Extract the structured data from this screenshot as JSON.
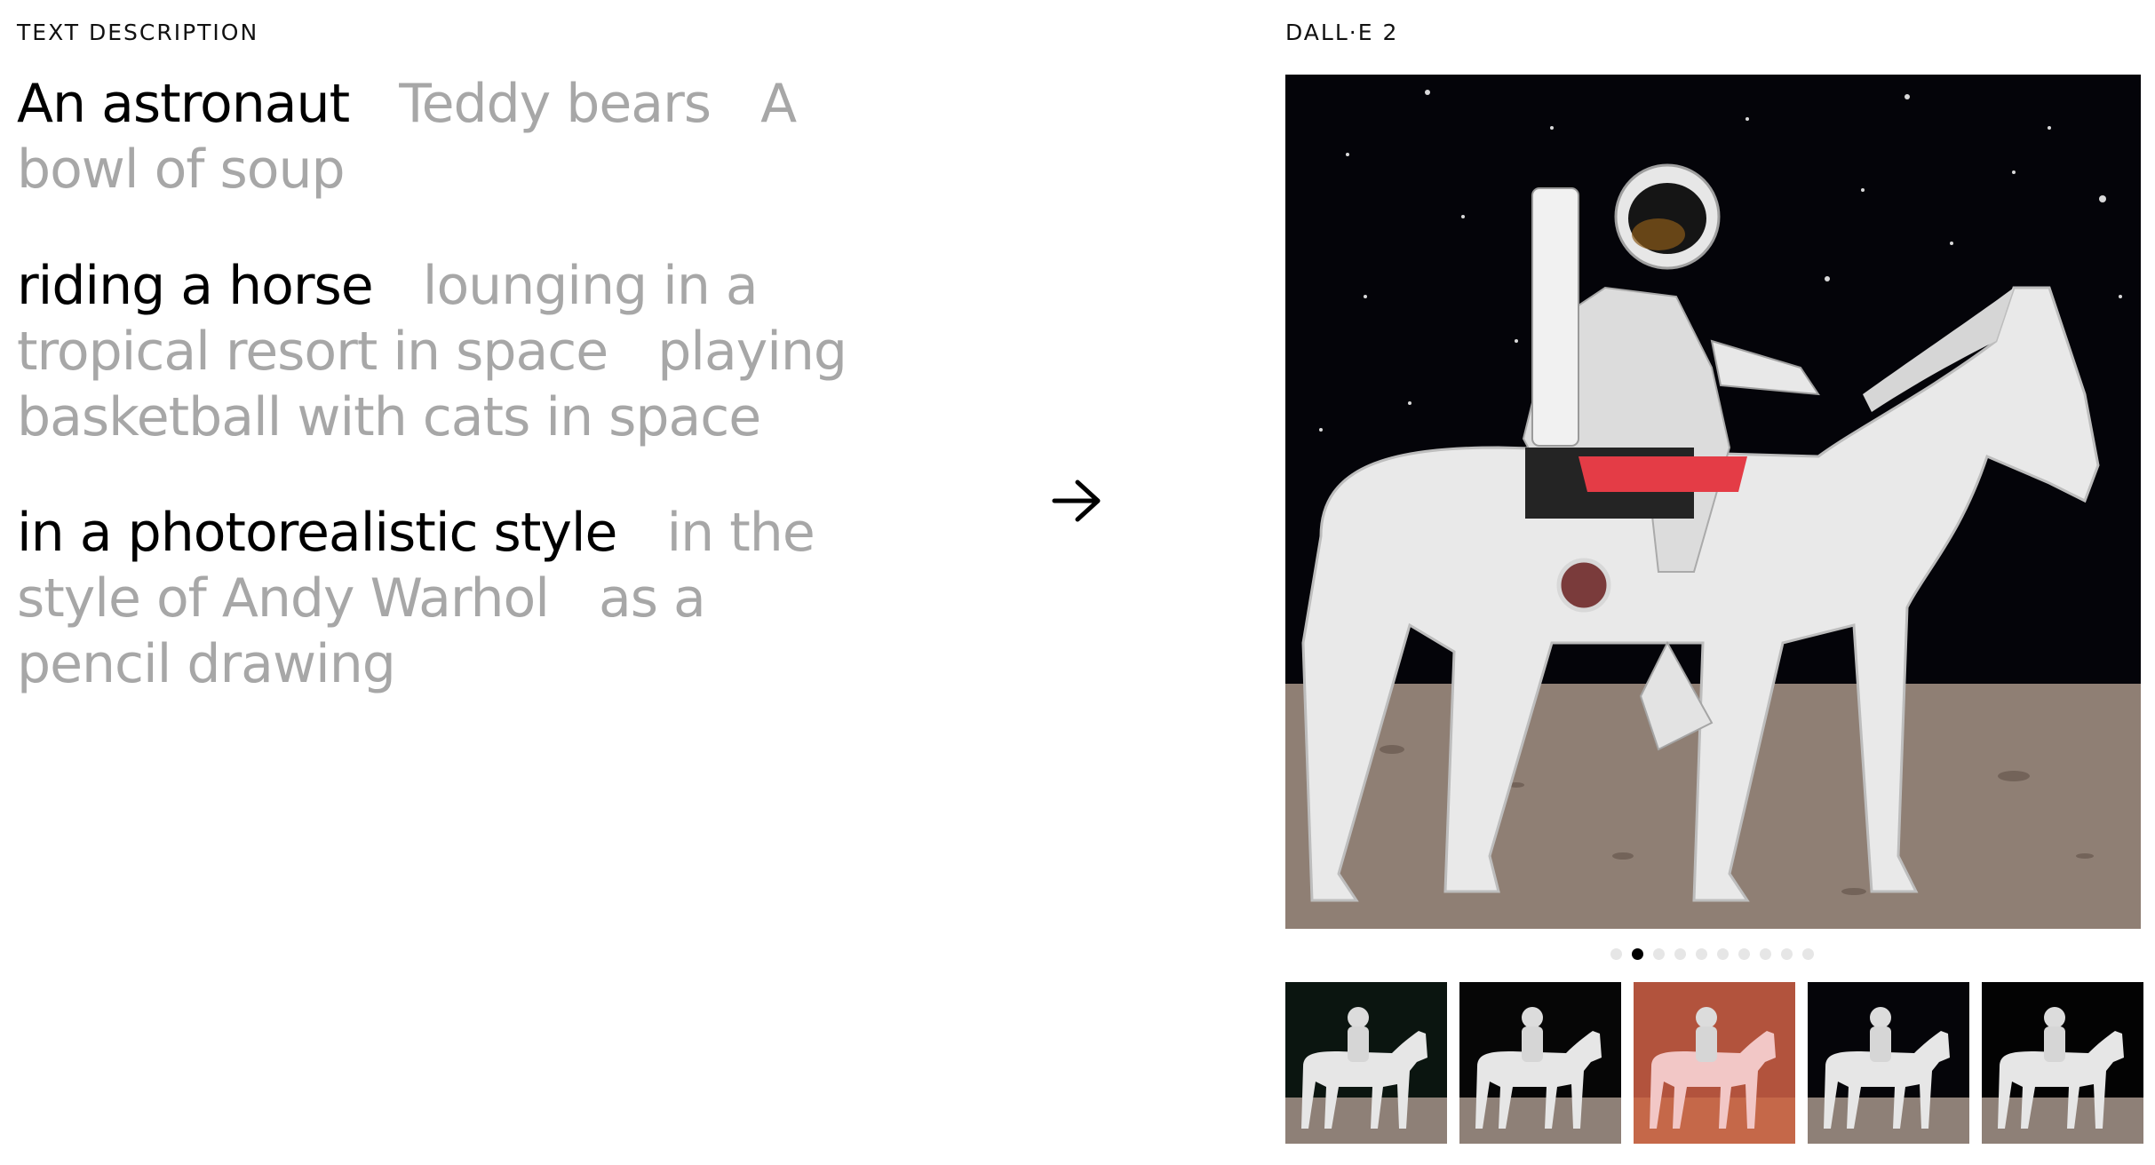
{
  "left_label": "TEXT DESCRIPTION",
  "right_label": "DALL·E 2",
  "subject_options": [
    "An astronaut",
    "Teddy bears",
    "A bowl of soup"
  ],
  "action_options": [
    "riding a horse",
    "lounging in a tropical resort in space",
    "playing basketball with cats in space"
  ],
  "style_options": [
    "in a photorealistic style",
    "in the style of Andy Warhol",
    "as a pencil drawing"
  ],
  "selected": {
    "subject": 0,
    "action": 0,
    "style": 0
  },
  "arrow_icon": "arrow-right-icon",
  "carousel": {
    "dot_count": 10,
    "active_dot": 1
  },
  "thumbnails": [
    {
      "icon": "astronaut-horse-space-thumb",
      "bg": "#0b1510"
    },
    {
      "icon": "astronaut-horse-moon-thumb",
      "bg": "#060606"
    },
    {
      "icon": "astronaut-pink-horse-mars-thumb",
      "bg": "#b2533d"
    },
    {
      "icon": "astronaut-horse-dark-thumb",
      "bg": "#050509"
    },
    {
      "icon": "astronaut-horse-moon-alt-thumb",
      "bg": "#030303"
    }
  ],
  "colors": {
    "active_text": "#000000",
    "inactive_text": "#a7a7a7",
    "dot_inactive": "#e6e6e6",
    "dot_active": "#000000"
  }
}
